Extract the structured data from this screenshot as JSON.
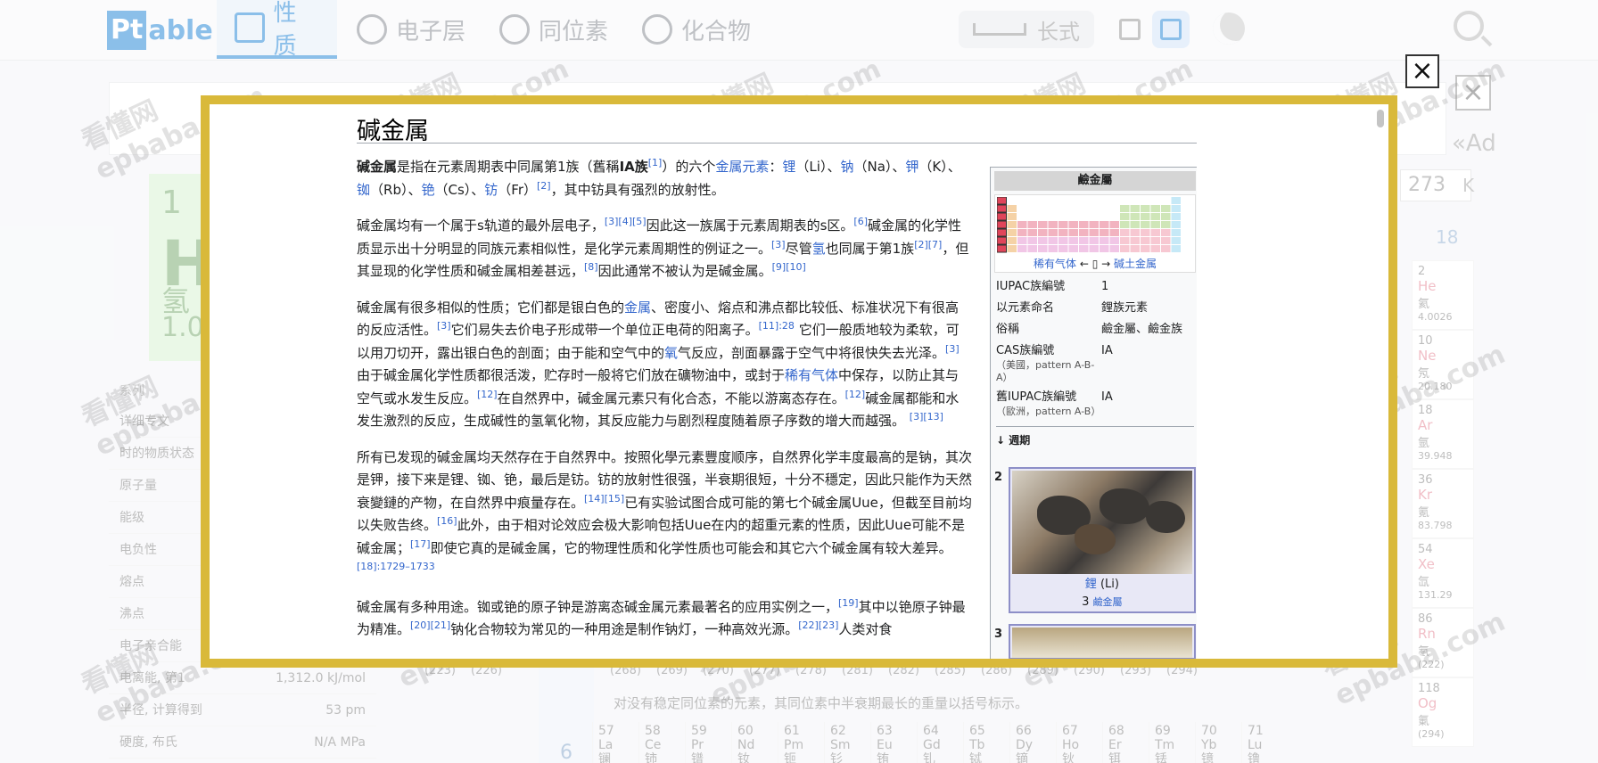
{
  "app": {
    "logo_pt": "Pt",
    "logo_rest": "able",
    "nav_tabs": [
      {
        "label": "性质",
        "icon": "list-icon",
        "active": true
      },
      {
        "label": "电子层",
        "icon": "atom-icon",
        "active": false
      },
      {
        "label": "同位素",
        "icon": "isotope-icon",
        "active": false
      },
      {
        "label": "化合物",
        "icon": "compound-icon",
        "active": false
      }
    ],
    "long_form_label": "长式",
    "ad_text": "«Ad",
    "temp_value": "273",
    "temp_unit": "K",
    "group_18": "18",
    "hydrogen": {
      "number": "1",
      "symbol": "H",
      "name": "氢",
      "mass": "1.0"
    },
    "prop_header": "系列",
    "properties": [
      {
        "label": "详细专文",
        "value": ""
      },
      {
        "label": "时的物质状态",
        "value": ""
      },
      {
        "label": "原子量",
        "value": ""
      },
      {
        "label": "能级",
        "value": ""
      },
      {
        "label": "电负性",
        "value": ""
      },
      {
        "label": "熔点",
        "value": ""
      },
      {
        "label": "沸点",
        "value": ""
      },
      {
        "label": "电子亲合能",
        "value": ""
      },
      {
        "label": "电离能, 第1",
        "value": "1,312.0 kJ/mol"
      },
      {
        "label": "半径, 计算得到",
        "value": "53 pm"
      },
      {
        "label": "硬度, 布氏",
        "value": "N/A MPa"
      }
    ],
    "noble_gases": [
      {
        "num": "2",
        "sym": "He",
        "name": "氦",
        "mass": "4.0026"
      },
      {
        "num": "10",
        "sym": "Ne",
        "name": "氖",
        "mass": "20.180"
      },
      {
        "num": "18",
        "sym": "Ar",
        "name": "氩",
        "mass": "39.948"
      },
      {
        "num": "36",
        "sym": "Kr",
        "name": "氪",
        "mass": "83.798"
      },
      {
        "num": "54",
        "sym": "Xe",
        "name": "氙",
        "mass": "131.29"
      },
      {
        "num": "86",
        "sym": "Rn",
        "name": "氡",
        "mass": "(222)"
      },
      {
        "num": "118",
        "sym": "Og",
        "name": "氭",
        "mass": "(294)"
      }
    ],
    "masses_row": [
      "(223)",
      "(226)",
      "",
      "(267)",
      "(268)",
      "(269)",
      "(270)",
      "(277)",
      "(278)",
      "(281)",
      "(282)",
      "(285)",
      "(286)",
      "(289)",
      "(290)",
      "(293)",
      "(294)"
    ],
    "isotope_note": "对没有稳定同位素的元素，其同位素中半衰期最长的重量以括号标示。",
    "period_6": "6",
    "lanthanides": [
      {
        "num": "57",
        "sym": "La",
        "name": "镧"
      },
      {
        "num": "58",
        "sym": "Ce",
        "name": "铈"
      },
      {
        "num": "59",
        "sym": "Pr",
        "name": "镨"
      },
      {
        "num": "60",
        "sym": "Nd",
        "name": "钕"
      },
      {
        "num": "61",
        "sym": "Pm",
        "name": "钷"
      },
      {
        "num": "62",
        "sym": "Sm",
        "name": "钐"
      },
      {
        "num": "63",
        "sym": "Eu",
        "name": "铕"
      },
      {
        "num": "64",
        "sym": "Gd",
        "name": "钆"
      },
      {
        "num": "65",
        "sym": "Tb",
        "name": "铽"
      },
      {
        "num": "66",
        "sym": "Dy",
        "name": "镝"
      },
      {
        "num": "67",
        "sym": "Ho",
        "name": "钬"
      },
      {
        "num": "68",
        "sym": "Er",
        "name": "铒"
      },
      {
        "num": "69",
        "sym": "Tm",
        "name": "铥"
      },
      {
        "num": "70",
        "sym": "Yb",
        "name": "镱"
      },
      {
        "num": "71",
        "sym": "Lu",
        "name": "镥"
      }
    ]
  },
  "watermark": {
    "line1": "看懂网",
    "line2": "epbaba.com"
  },
  "modal": {
    "close_label": "×",
    "title": "碱金属",
    "paragraphs": [
      "<b>碱金属</b>是指在元素周期表中同属第1族（舊稱<b>ⅠA族</b><sup>[1]</sup>）的六个<span class=\"lnk\">金属元素</span>：<span class=\"lnk\">锂</span>（Li）、<span class=\"lnk\">钠</span>（Na）、<span class=\"lnk\">钾</span>（K）、<span class=\"lnk\">铷</span>（Rb）、<span class=\"lnk\">铯</span>（Cs）、<span class=\"lnk\">钫</span>（Fr）<sup>[2]</sup>，其中钫具有强烈的放射性。",
      "碱金属均有一个属于s轨道的最外层电子，<sup>[3][4][5]</sup>因此这一族属于元素周期表的s区。<sup>[6]</sup>碱金属的化学性质显示出十分明显的同族元素相似性，是化学元素周期性的例证之一。<sup>[3]</sup>尽管<span class=\"lnk\">氢</span>也同属于第1族<sup>[2][7]</sup>，但其显现的化学性质和碱金属相差甚远，<sup>[8]</sup>因此通常不被认为是碱金属。<sup>[9][10]</sup>",
      "碱金属有很多相似的性质；它们都是银白色的<span class=\"lnk\">金属</span>、密度小、熔点和沸点都比较低、标准状况下有很高的反应活性。<sup>[3]</sup>它们易失去价电子形成带一个单位正电荷的阳离子。<sup>[11]:28</sup> 它们一般质地较为柔软，可以用刀切开，露出银白色的剖面；由于能和空气中的<span class=\"lnk\">氧</span>气反应，剖面暴露于空气中将很快失去光泽。<sup>[3]</sup>由于碱金属化学性质都很活泼，贮存时一般将它们放在礦物油中，或封于<span class=\"lnk\">稀有气体</span>中保存，以防止其与空气或水发生反应。<sup>[12]</sup>在自然界中，碱金属元素只有化合态，不能以游离态存在。<sup>[12]</sup>碱金属都能和水发生激烈的反应，生成碱性的氢氧化物，其反应能力与剧烈程度随着原子序数的增大而越强。 <sup>[3][13]</sup>",
      "所有已发现的碱金属均天然存在于自然界中。按照化學元素豐度顺序，自然界化学丰度最高的是钠，其次是钾，接下来是锂、铷、铯，最后是钫。钫的放射性很强，半衰期很短，十分不穩定，因此只能作为天然衰變鏈的产物，在自然界中痕量存在。<sup>[14][15]</sup>已有实验试图合成可能的第七个碱金属Uue，但截至目前均以失败告终。<sup>[16]</sup>此外，由于相对论效应会极大影响包括Uue在内的超重元素的性质，因此Uue可能不是碱金属；<sup>[17]</sup>即使它真的是碱金属，它的物理性质和化学性质也可能会和其它六个碱金属有较大差异。<sup>[18]:1729–1733</sup>",
      "碱金属有多种用途。铷或铯的原子钟是游离态碱金属元素最著名的应用实例之一，<sup>[19]</sup>其中以铯原子钟最为精准。<sup>[20][21]</sup>钠化合物较为常见的一种用途是制作钠灯，一种高效光源。<sup>[22][23]</sup>人类对食"
    ],
    "infobox": {
      "header": "鹼金屬",
      "nav_left": "稀有气体",
      "nav_right": "碱土金属",
      "rows": [
        {
          "k": "IUPAC族編號",
          "note": "",
          "v": "1"
        },
        {
          "k": "以元素命名",
          "note": "",
          "v": "鋰族元素"
        },
        {
          "k": "俗稱",
          "note": "",
          "v": "鹼金屬、鹼金族"
        },
        {
          "k": "CAS族編號",
          "note": "（美國，pattern A-B-A）",
          "v": "IA"
        },
        {
          "k": "舊IUPAC族編號",
          "note": "（歐洲，pattern A-B）",
          "v": "IA"
        }
      ],
      "period_label": "↓ 週期",
      "elements": [
        {
          "period": "2",
          "name": "鋰",
          "symbol": "(Li)",
          "number": "3",
          "group": "鹼金屬"
        },
        {
          "period": "3",
          "name": "",
          "symbol": "",
          "number": "",
          "group": ""
        }
      ]
    }
  }
}
